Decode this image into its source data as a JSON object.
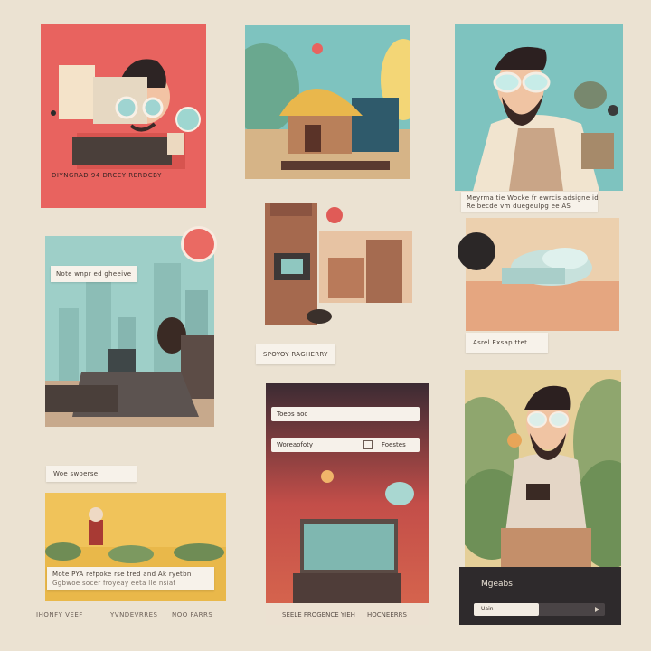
{
  "colors": {
    "background": "#ebe2d2",
    "coral": "#e8635f",
    "teal": "#7ec3bf",
    "sand": "#e9c9a0",
    "mustard": "#f0c35a",
    "plum": "#3b2b33"
  },
  "cards": {
    "top_left": {
      "caption": "DIYNGRAD 94 DRCEY   RERDCBY"
    },
    "top_right": {
      "caption_line1": "Meyrma tie Wocke fr ewrcis adsigne ide",
      "caption_line2": "Relbecde vm duegeulpg ee AS"
    },
    "mid_left": {
      "header_label": "Note wnpr ed gheeive",
      "footer_label": "Woe swoerse"
    },
    "mid_center": {
      "caption": "SPOYOY RAGHERRY"
    },
    "mid_right": {
      "caption": "Asrel Exsap ttet"
    },
    "bottom_left": {
      "caption_line1": "Mote PYA refpoke rse tred and Ak ryetbn",
      "caption_line2": "Ggbwoe socer froyeay eeta lle nsiat",
      "footer_items": [
        "IHONFY VEEF",
        "YVNDEVRRES",
        "NOO FARRS"
      ]
    },
    "bottom_center": {
      "field1_value": "Toeos aoc",
      "field2_value": "Woreaofoty",
      "field2_suffix": "Foestes",
      "footer": [
        "SEELE FROGENCE YIEH",
        "HOCNEERRS"
      ]
    },
    "bottom_right": {
      "title": "Mgeabs",
      "input_value": "Uain"
    }
  }
}
